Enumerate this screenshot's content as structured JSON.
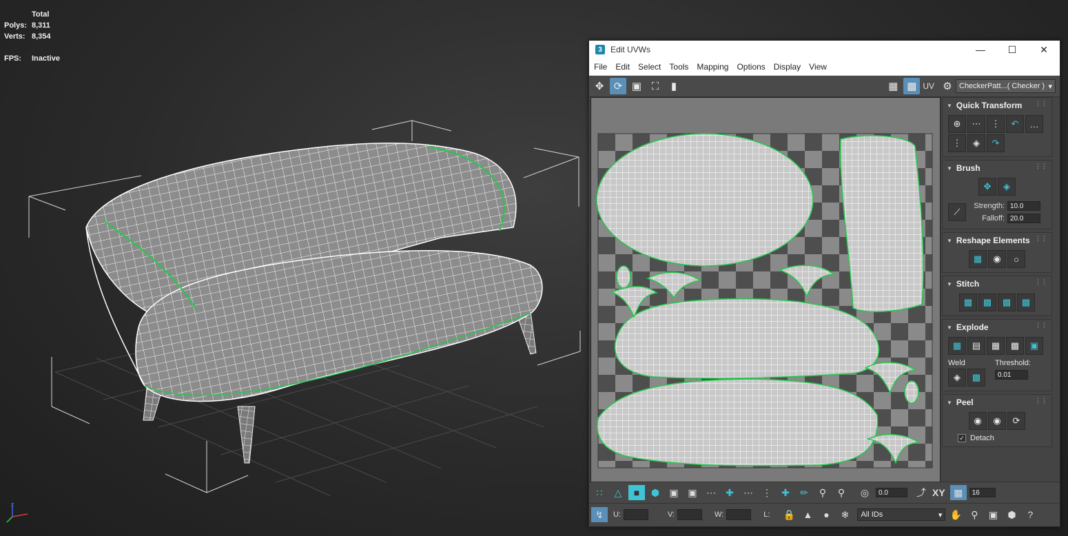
{
  "viewport": {
    "stats_header": "Total",
    "polys_label": "Polys:",
    "polys_value": "8,311",
    "verts_label": "Verts:",
    "verts_value": "8,354",
    "fps_label": "FPS:",
    "fps_value": "Inactive"
  },
  "window": {
    "title": "Edit UVWs",
    "app_icon": "3",
    "menu": [
      "File",
      "Edit",
      "Select",
      "Tools",
      "Mapping",
      "Options",
      "Display",
      "View"
    ],
    "uv_label": "UV",
    "texture_select": "CheckerPatt...( Checker )"
  },
  "rollouts": {
    "quick_transform": "Quick Transform",
    "brush": "Brush",
    "strength_label": "Strength:",
    "strength_value": "10.0",
    "falloff_label": "Falloff:",
    "falloff_value": "20.0",
    "reshape": "Reshape Elements",
    "stitch": "Stitch",
    "explode": "Explode",
    "weld": "Weld",
    "threshold_label": "Threshold:",
    "threshold_value": "0.01",
    "peel": "Peel",
    "detach_label": "Detach"
  },
  "bottom": {
    "rotate_value": "0.0",
    "xy_label": "XY",
    "grid_value": "16",
    "u_label": "U:",
    "v_label": "V:",
    "w_label": "W:",
    "l_label": "L:",
    "ids_select": "All IDs"
  },
  "colors": {
    "accent": "#3fc4d6",
    "seam": "#22c84a",
    "wire": "#ffffff",
    "panel": "#444444"
  }
}
